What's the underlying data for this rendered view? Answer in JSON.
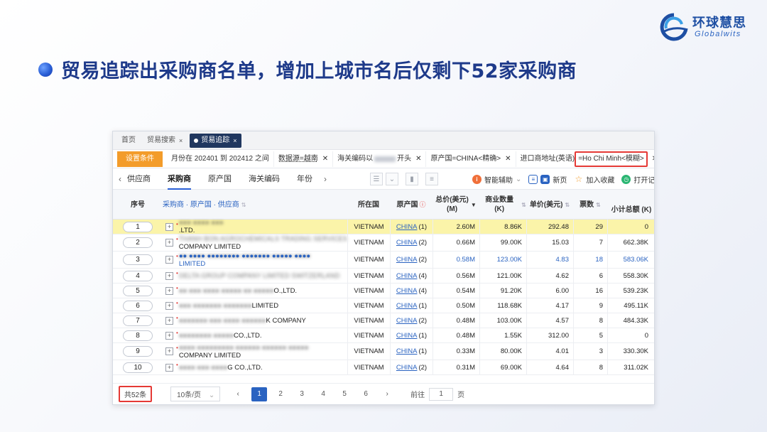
{
  "brand": {
    "cn": "环球慧思",
    "en": "Globalwits"
  },
  "headline": "贸易追踪出采购商名单，增加上城市名后仅剩下52家采购商",
  "tabs": [
    {
      "label": "首页",
      "closable": false,
      "active": false
    },
    {
      "label": "贸易搜索",
      "closable": true,
      "active": false
    },
    {
      "label": "贸易追踪",
      "closable": true,
      "active": true
    }
  ],
  "filters": {
    "set_label": "设置条件",
    "chips": [
      {
        "text": "月份在 202401 到 202412 之间",
        "closable": false
      },
      {
        "text": "数据源=越南",
        "closable": true
      },
      {
        "text_before": "海关编码以",
        "text_after": "开头",
        "closable": true
      },
      {
        "text": "原产国=CHINA<精确>",
        "closable": true
      },
      {
        "text": "进口商地址(英语)",
        "closable": false
      },
      {
        "text": "=Ho Chi Minh<模糊>",
        "closable": true,
        "highlight": true
      }
    ]
  },
  "subnav": {
    "tabs": [
      "供应商",
      "采购商",
      "原产国",
      "海关编码",
      "年份"
    ],
    "active": "采购商",
    "actions": [
      "智能辅助",
      "新页",
      "加入收藏",
      "打开记录"
    ]
  },
  "table": {
    "headers": {
      "index": "序号",
      "name": "采购商 · 原产国 · 供应商",
      "country": "所在国",
      "origin": "原产国",
      "total_value": "总价(美元)\n(M)",
      "qty": "商业数量 (K)",
      "unit_price": "单价(美元)",
      "count": "票数",
      "subtotal": "小计总额 (K)"
    },
    "rows": [
      {
        "idx": "1",
        "name_lines": [
          "●●● ●●●● ●●●",
          ".LTD."
        ],
        "blur_first": true,
        "country": "VIETNAM",
        "origin": "CHINA",
        "origin_n": "(1)",
        "total": "2.60M",
        "qty": "8.86K",
        "price": "292.48",
        "count": "29",
        "subtotal": "0",
        "selected": true
      },
      {
        "idx": "2",
        "name_lines": [
          "THANH BON AGROCHEMICALS TRADING SERVICES",
          "COMPANY LIMITED"
        ],
        "blur_first": true,
        "country": "VIETNAM",
        "origin": "CHINA",
        "origin_n": "(2)",
        "total": "0.66M",
        "qty": "99.00K",
        "price": "15.03",
        "count": "7",
        "subtotal": "662.38K"
      },
      {
        "idx": "3",
        "name_lines": [
          "●● ●●●● ●●●●●●●● ●●●●●●● ●●●●● ●●●●",
          "LIMITED"
        ],
        "blur_first": true,
        "country": "VIETNAM",
        "origin": "CHINA",
        "origin_n": "(2)",
        "total": "0.58M",
        "qty": "123.00K",
        "price": "4.83",
        "count": "18",
        "subtotal": "583.06K",
        "blue": true
      },
      {
        "idx": "4",
        "name_lines": [
          "DELTA GROUP COMPANY LIMITED SWITZERLAND"
        ],
        "blur_first": true,
        "country": "VIETNAM",
        "origin": "CHINA",
        "origin_n": "(4)",
        "total": "0.56M",
        "qty": "121.00K",
        "price": "4.62",
        "count": "6",
        "subtotal": "558.30K"
      },
      {
        "idx": "5",
        "name_lines": [
          "●● ●●● ●●●● ●●●●● ●● ●●●●●",
          "O.,LTD."
        ],
        "blur_first": true,
        "inline": true,
        "country": "VIETNAM",
        "origin": "CHINA",
        "origin_n": "(4)",
        "total": "0.54M",
        "qty": "91.20K",
        "price": "6.00",
        "count": "16",
        "subtotal": "539.23K"
      },
      {
        "idx": "6",
        "name_lines": [
          "●●● ●●●●●●● ●●●●●●●",
          "LIMITED"
        ],
        "blur_first": true,
        "inline": true,
        "country": "VIETNAM",
        "origin": "CHINA",
        "origin_n": "(1)",
        "total": "0.50M",
        "qty": "118.68K",
        "price": "4.17",
        "count": "9",
        "subtotal": "495.11K"
      },
      {
        "idx": "7",
        "name_lines": [
          "●●●●●●● ●●● ●●●● ●●●●●●",
          "K COMPANY"
        ],
        "blur_first": true,
        "inline": true,
        "country": "VIETNAM",
        "origin": "CHINA",
        "origin_n": "(2)",
        "total": "0.48M",
        "qty": "103.00K",
        "price": "4.57",
        "count": "8",
        "subtotal": "484.33K"
      },
      {
        "idx": "8",
        "name_lines": [
          "●●●●●●●● ●●●●●",
          "CO.,LTD."
        ],
        "blur_first": true,
        "inline": true,
        "country": "VIETNAM",
        "origin": "CHINA",
        "origin_n": "(1)",
        "total": "0.48M",
        "qty": "1.55K",
        "price": "312.00",
        "count": "5",
        "subtotal": "0"
      },
      {
        "idx": "9",
        "name_lines": [
          "●●●● ●●●●●●●●● ●●●●●● ●●●●●● ●●●●●",
          "COMPANY LIMITED"
        ],
        "blur_first": true,
        "country": "VIETNAM",
        "origin": "CHINA",
        "origin_n": "(1)",
        "total": "0.33M",
        "qty": "80.00K",
        "price": "4.01",
        "count": "3",
        "subtotal": "330.30K"
      },
      {
        "idx": "10",
        "name_lines": [
          "●●●● ●●● ●●●●",
          "G CO.,LTD."
        ],
        "blur_first": true,
        "inline": true,
        "country": "VIETNAM",
        "origin": "CHINA",
        "origin_n": "(2)",
        "total": "0.31M",
        "qty": "69.00K",
        "price": "4.64",
        "count": "8",
        "subtotal": "311.02K"
      }
    ]
  },
  "footer": {
    "total": "共52条",
    "page_size": "10条/页",
    "pages": [
      "1",
      "2",
      "3",
      "4",
      "5",
      "6"
    ],
    "current_page": "1",
    "goto_label": "前往",
    "goto_value": "1",
    "goto_suffix": "页"
  }
}
